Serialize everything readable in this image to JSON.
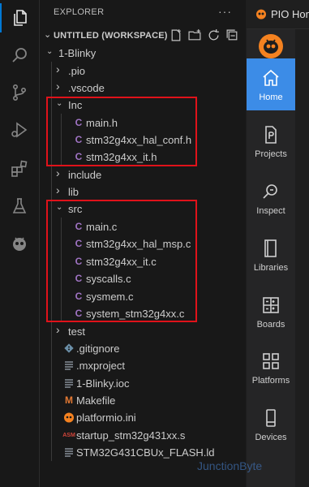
{
  "activity_bar": {
    "items": [
      {
        "icon": "files-icon",
        "active": true
      },
      {
        "icon": "search-icon",
        "active": false
      },
      {
        "icon": "source-control-icon",
        "active": false
      },
      {
        "icon": "run-debug-icon",
        "active": false
      },
      {
        "icon": "extensions-icon",
        "active": false
      },
      {
        "icon": "testing-flask-icon",
        "active": false
      },
      {
        "icon": "platformio-alien-icon",
        "active": false
      }
    ]
  },
  "explorer": {
    "title": "EXPLORER",
    "more_glyph": "···",
    "workspace_title": "UNTITLED (WORKSPACE)",
    "workspace_actions": [
      "new-file-icon",
      "new-folder-icon",
      "refresh-icon",
      "collapse-all-icon"
    ],
    "tree": [
      {
        "label": "1-Blinky",
        "type": "folder-open"
      },
      {
        "label": ".pio",
        "type": "folder"
      },
      {
        "label": ".vscode",
        "type": "folder"
      },
      {
        "label": "Inc",
        "type": "folder-open"
      },
      {
        "label": "main.h",
        "type": "c-header"
      },
      {
        "label": "stm32g4xx_hal_conf.h",
        "type": "c-header"
      },
      {
        "label": "stm32g4xx_it.h",
        "type": "c-header"
      },
      {
        "label": "include",
        "type": "folder"
      },
      {
        "label": "lib",
        "type": "folder"
      },
      {
        "label": "src",
        "type": "folder-open"
      },
      {
        "label": "main.c",
        "type": "c-source"
      },
      {
        "label": "stm32g4xx_hal_msp.c",
        "type": "c-source"
      },
      {
        "label": "stm32g4xx_it.c",
        "type": "c-source"
      },
      {
        "label": "syscalls.c",
        "type": "c-source"
      },
      {
        "label": "sysmem.c",
        "type": "c-source"
      },
      {
        "label": "system_stm32g4xx.c",
        "type": "c-source"
      },
      {
        "label": "test",
        "type": "folder"
      },
      {
        "label": ".gitignore",
        "type": "git"
      },
      {
        "label": ".mxproject",
        "type": "lines"
      },
      {
        "label": "1-Blinky.ioc",
        "type": "lines"
      },
      {
        "label": "Makefile",
        "type": "makefile"
      },
      {
        "label": "platformio.ini",
        "type": "pio"
      },
      {
        "label": "startup_stm32g431xx.s",
        "type": "asm"
      },
      {
        "label": "STM32G431CBUx_FLASH.ld",
        "type": "lines"
      }
    ],
    "icon_glyphs": {
      "c_source": "C",
      "c_header": "C",
      "makefile": "M",
      "asm": "ASM"
    }
  },
  "pio": {
    "tab_title": "PIO Home",
    "tab_icon": "platformio-alien-icon",
    "nav": [
      {
        "label": "Home",
        "icon": "home-icon",
        "active": true
      },
      {
        "label": "Projects",
        "icon": "projects-icon",
        "active": false
      },
      {
        "label": "Inspect",
        "icon": "inspect-icon",
        "active": false
      },
      {
        "label": "Libraries",
        "icon": "libraries-icon",
        "active": false
      },
      {
        "label": "Boards",
        "icon": "boards-icon",
        "active": false
      },
      {
        "label": "Platforms",
        "icon": "platforms-icon",
        "active": false
      },
      {
        "label": "Devices",
        "icon": "devices-icon",
        "active": false
      }
    ]
  },
  "colors": {
    "accent": "#0078d4",
    "pio_active": "#3c8ce7",
    "highlight_box": "#e0121a",
    "c_icon": "#a074c4",
    "makefile_icon": "#e37933",
    "pio_orange": "#f58220"
  },
  "watermark": "JunctionByte"
}
